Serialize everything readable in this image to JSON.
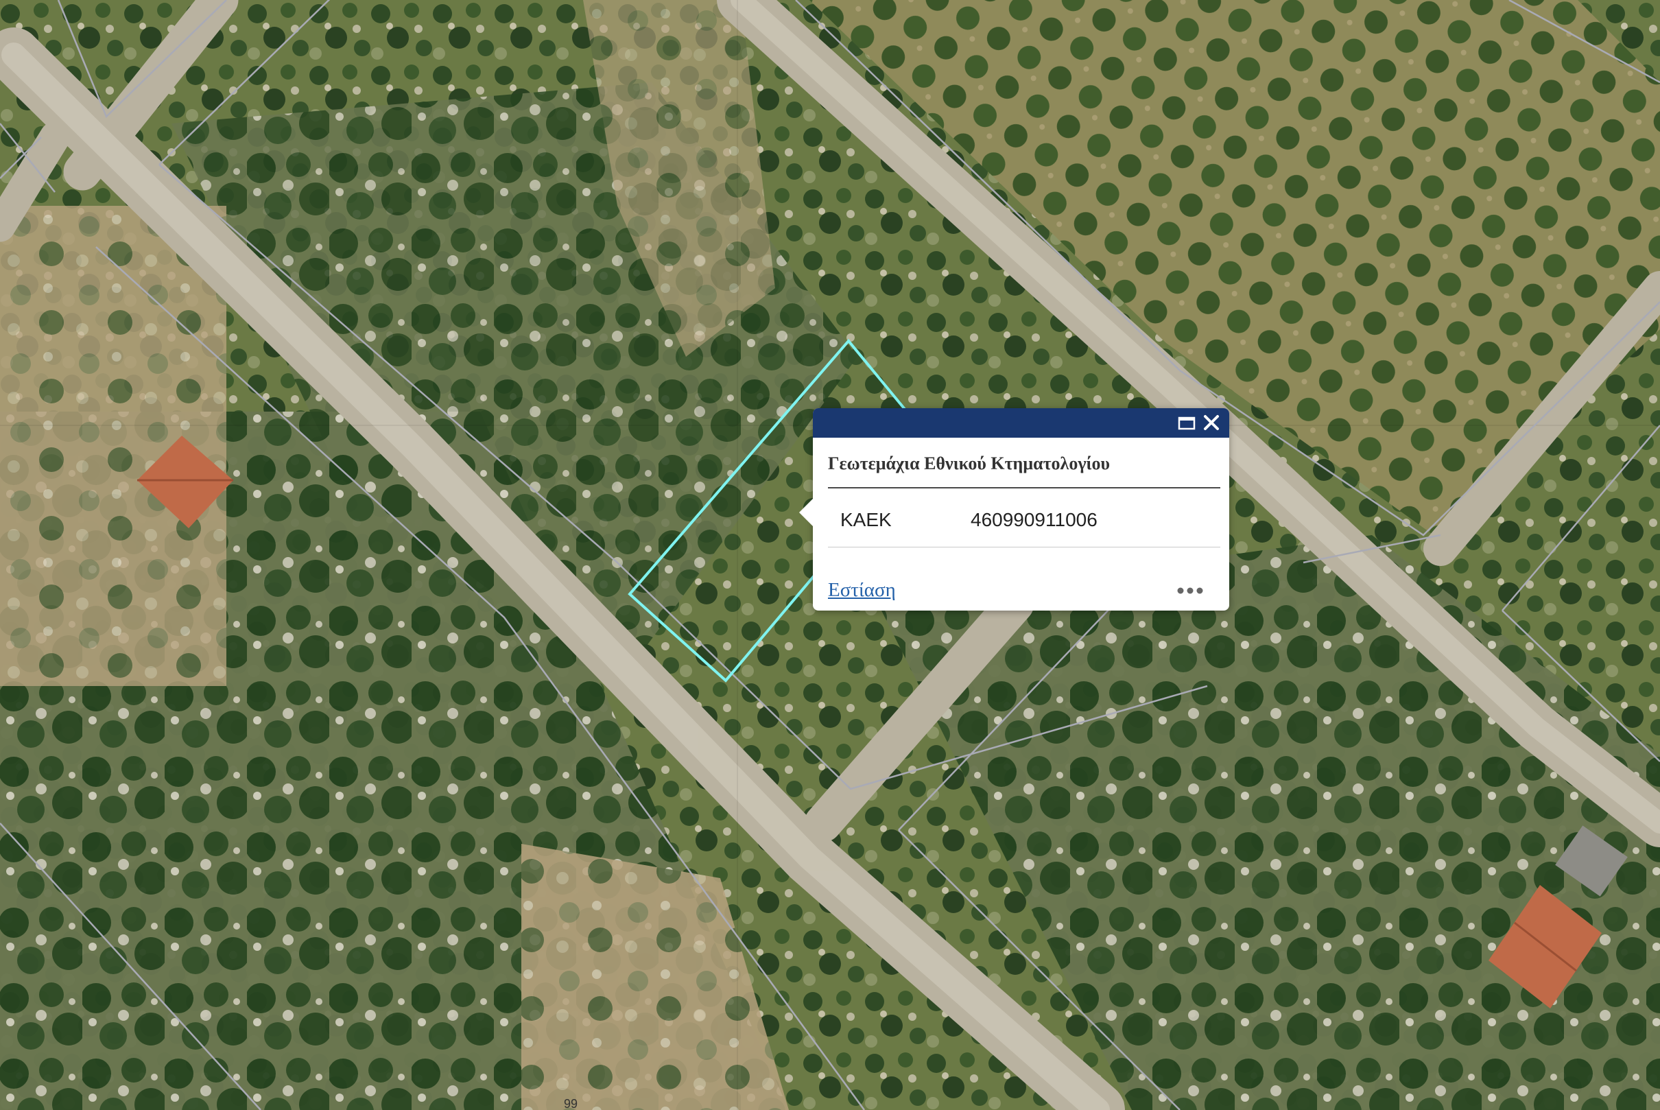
{
  "popup": {
    "title": "Γεωτεμάχια Εθνικού Κτηματολογίου",
    "attributes": [
      {
        "key": "ΚΑΕΚ",
        "value": "460990911006"
      }
    ],
    "zoom_link": "Εστίαση",
    "header_icons": [
      "maximize-icon",
      "close-icon"
    ],
    "more_icon": "ellipsis-icon",
    "header_color": "#1a3870"
  },
  "map": {
    "basemap": "satellite-imagery",
    "selected_parcel_outline_color": "#7ff3f0",
    "parcel_boundary_color": "#a9aab5",
    "edge_label": "99"
  }
}
